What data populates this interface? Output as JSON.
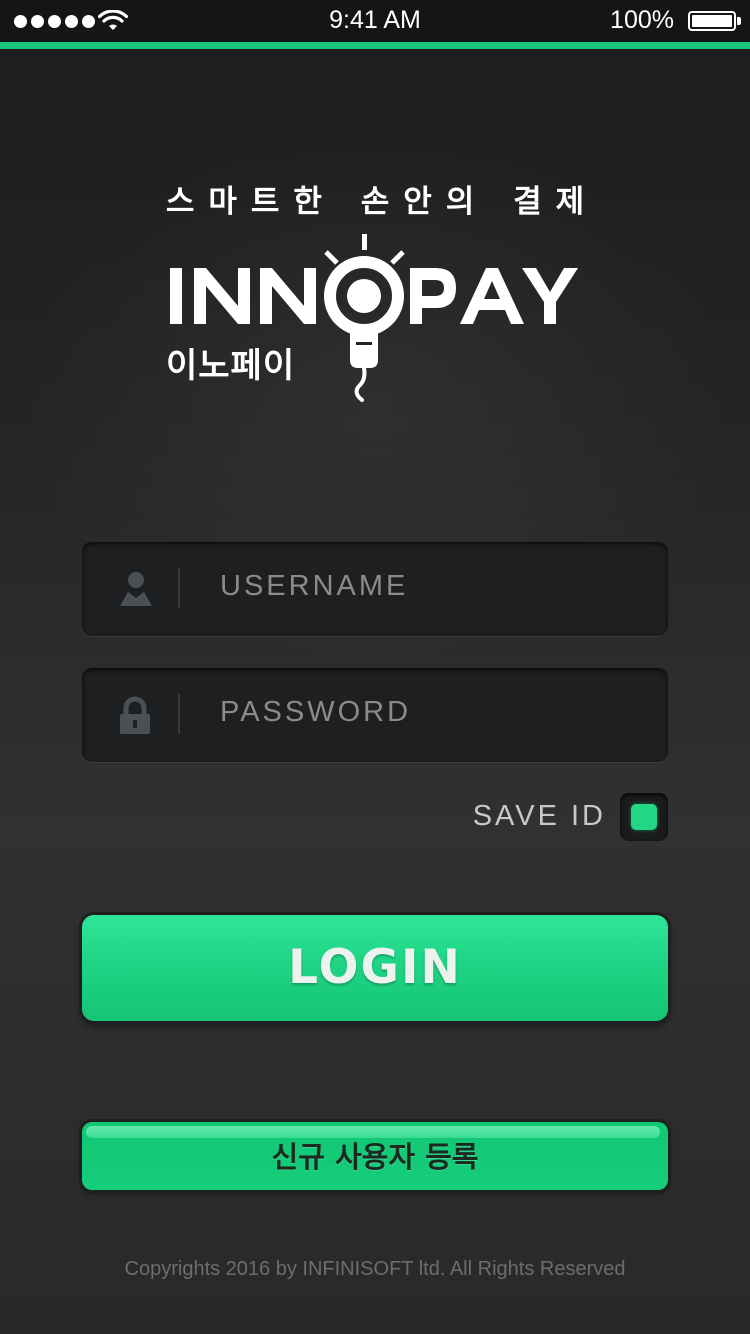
{
  "status_bar": {
    "time": "9:41 AM",
    "battery_percent": "100%",
    "signal_icon": "signal-dots-icon",
    "wifi_icon": "wifi-icon",
    "battery_icon": "battery-icon"
  },
  "brand": {
    "tagline": "스마트한 손안의 결제",
    "logo_text": "INNOPAY",
    "logo_korean": "이노페이",
    "logo_icon": "lightbulb-plug-icon"
  },
  "form": {
    "username": {
      "placeholder": "USERNAME",
      "value": "",
      "icon": "user-icon"
    },
    "password": {
      "placeholder": "PASSWORD",
      "value": "",
      "icon": "lock-icon"
    },
    "save_id": {
      "label": "SAVE ID",
      "checked": true
    }
  },
  "buttons": {
    "login_label": "LOGIN",
    "register_label": "신규 사용자 등록"
  },
  "footer": {
    "copyright": "Copyrights 2016 by INFINISOFT ltd. All Rights Reserved"
  },
  "colors": {
    "accent_green": "#1ed585",
    "status_bar_bg": "#141516",
    "background_dark": "#232425"
  }
}
